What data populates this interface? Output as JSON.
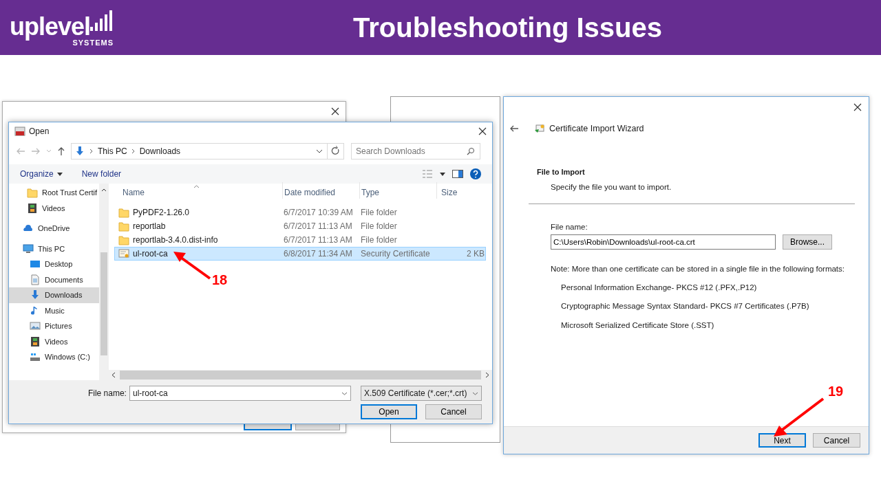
{
  "header": {
    "logo": {
      "word": "uplevel",
      "sub": "SYSTEMS"
    },
    "title": "Troubleshooting Issues"
  },
  "open_dialog": {
    "title": "Open",
    "path": [
      "This PC",
      "Downloads"
    ],
    "search": {
      "placeholder": "Search Downloads"
    },
    "toolbar": [
      "Organize",
      "New folder"
    ],
    "nav": {
      "quick_access_items": [
        {
          "label": "Root Trust Certif",
          "kind": "folder",
          "selected": false
        },
        {
          "label": "Videos",
          "kind": "video",
          "selected": false
        }
      ],
      "items": [
        {
          "label": "OneDrive",
          "kind": "cloud",
          "selected": false
        },
        {
          "label": "This PC",
          "kind": "pc",
          "selected": false,
          "children": [
            {
              "label": "Desktop",
              "kind": "desktop",
              "selected": false
            },
            {
              "label": "Documents",
              "kind": "document",
              "selected": false
            },
            {
              "label": "Downloads",
              "kind": "download",
              "selected": true
            },
            {
              "label": "Music",
              "kind": "music",
              "selected": false
            },
            {
              "label": "Pictures",
              "kind": "picture",
              "selected": false
            },
            {
              "label": "Videos",
              "kind": "video",
              "selected": false
            },
            {
              "label": "Windows (C:)",
              "kind": "drive",
              "selected": false
            }
          ]
        }
      ]
    },
    "columns": [
      "Name",
      "Date modified",
      "Type",
      "Size"
    ],
    "files": [
      {
        "name": "PyPDF2-1.26.0",
        "date": "6/7/2017 10:39 AM",
        "type": "File folder",
        "kind": "folder",
        "selected": false
      },
      {
        "name": "reportlab",
        "date": "6/7/2017 11:13 AM",
        "type": "File folder",
        "kind": "folder",
        "selected": false
      },
      {
        "name": "reportlab-3.4.0.dist-info",
        "date": "6/7/2017 11:13 AM",
        "type": "File folder",
        "kind": "folder",
        "selected": false
      },
      {
        "name": "ul-root-ca",
        "date": "6/8/2017 11:34 AM",
        "type": "Security Certificate",
        "size": "2 KB",
        "kind": "certificate",
        "selected": true
      }
    ],
    "file_name": {
      "label": "File name:",
      "value": "ul-root-ca"
    },
    "filter": "X.509 Certificate (*.cer;*.crt)",
    "buttons": [
      {
        "label": "Open",
        "default": true
      },
      {
        "label": "Cancel",
        "default": false
      }
    ]
  },
  "wizard": {
    "title": "Certificate Import Wizard",
    "heading": "File to Import",
    "subheading": "Specify the file you want to import.",
    "file_name": {
      "label": "File name:",
      "value": "C:\\Users\\Robin\\Downloads\\ul-root-ca.crt"
    },
    "browse": "Browse...",
    "note": "Note:  More than one certificate can be stored in a single file in the following formats:",
    "formats": [
      "Personal Information Exchange- PKCS #12 (.PFX,.P12)",
      "Cryptographic Message Syntax Standard- PKCS #7 Certificates (.P7B)",
      "Microsoft Serialized Certificate Store (.SST)"
    ],
    "buttons": [
      {
        "label": "Next",
        "default": true
      },
      {
        "label": "Cancel",
        "default": false
      }
    ]
  },
  "annotations": [
    {
      "number": "18"
    },
    {
      "number": "19"
    }
  ]
}
